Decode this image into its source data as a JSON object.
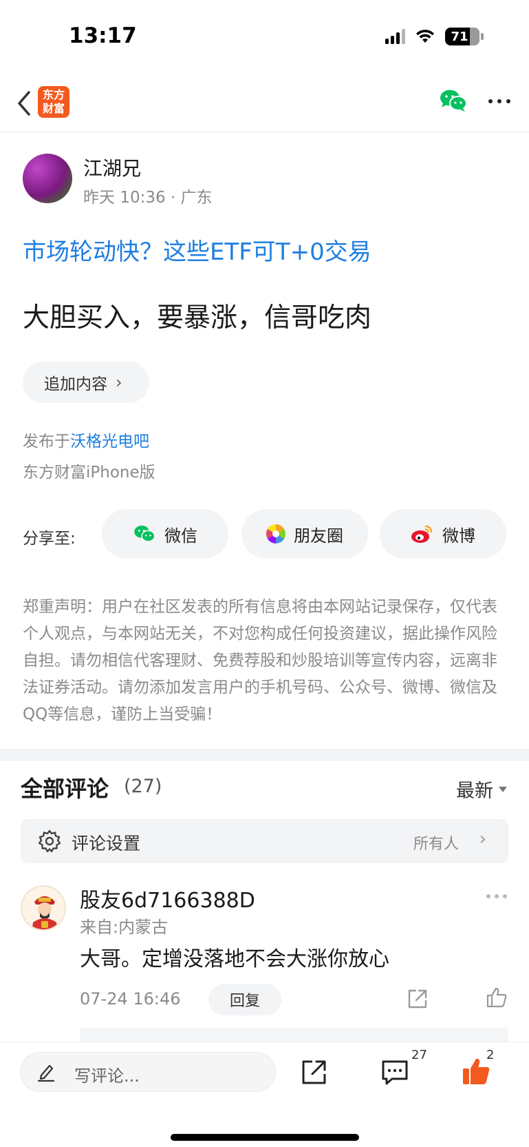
{
  "status_bar": {
    "time": "13:17",
    "battery": "71"
  },
  "nav": {
    "logo_line1": "东方",
    "logo_line2": "财富"
  },
  "author": {
    "name": "江湖兄",
    "meta": "昨天 10:36 · 广东"
  },
  "post": {
    "title": "市场轮动快？这些ETF可T+0交易",
    "body": "大胆买入，要暴涨，信哥吃肉",
    "add_content_label": "追加内容",
    "publish_prefix": "发布于",
    "publish_bar": "沃格光电吧",
    "client": "东方财富iPhone版"
  },
  "share": {
    "label": "分享至:",
    "wechat": "微信",
    "moments": "朋友圈",
    "weibo": "微博"
  },
  "disclaimer": "郑重声明：用户在社区发表的所有信息将由本网站记录保存，仅代表个人观点，与本网站无关，不对您构成任何投资建议，据此操作风险自担。请勿相信代客理财、免费荐股和炒股培训等宣传内容，远离非法证券活动。请勿添加发言用户的手机号码、公众号、微博、微信及QQ等信息，谨防上当受骗！",
  "comments": {
    "title": "全部评论",
    "count": "(27)",
    "sort": "最新",
    "settings_label": "评论设置",
    "settings_value": "所有人",
    "items": [
      {
        "user": "股友6d7166388D",
        "location": "来自:内蒙古",
        "text": "大哥。定增没落地不会大涨你放心",
        "time": "07-24 16:46",
        "reply_label": "回复"
      }
    ]
  },
  "bottom_bar": {
    "placeholder": "写评论...",
    "comment_count": "27",
    "like_count": "2"
  },
  "colors": {
    "accent_blue": "#1f7ee0",
    "brand_orange": "#f25a20",
    "like_orange": "#f25a20",
    "wechat_green": "#07c160"
  }
}
